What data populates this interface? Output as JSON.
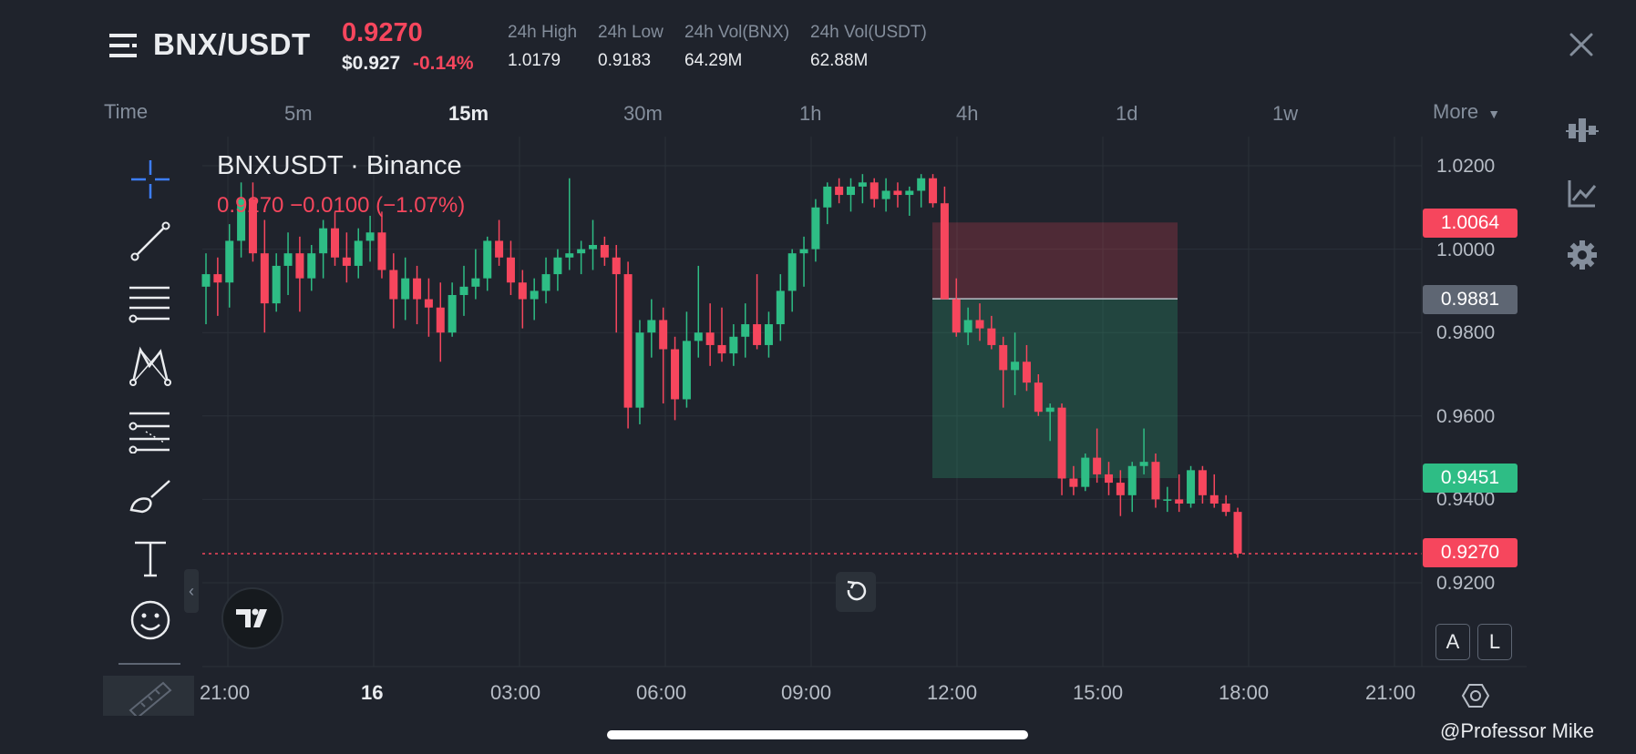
{
  "header": {
    "pair": "BNX/USDT",
    "price": "0.9270",
    "usd_price": "$0.927",
    "change_pct": "-0.14%",
    "stats": [
      {
        "label": "24h High",
        "value": "1.0179"
      },
      {
        "label": "24h Low",
        "value": "0.9183"
      },
      {
        "label": "24h Vol(BNX)",
        "value": "64.29M"
      },
      {
        "label": "24h Vol(USDT)",
        "value": "62.88M"
      }
    ]
  },
  "timeframes": {
    "time_label": "Time",
    "items": [
      "5m",
      "15m",
      "30m",
      "1h",
      "4h",
      "1d",
      "1w"
    ],
    "active": "15m",
    "more_label": "More"
  },
  "chart": {
    "title": "BNXUSDT · Binance",
    "ohlc_text": "0.9270  −0.0100 (−1.07%)",
    "position_tool": {
      "stop": "1.0064",
      "entry": "0.9881",
      "target": "0.9451"
    },
    "last_price": "0.9270",
    "auto_label": "A",
    "log_label": "L",
    "colors": {
      "up": "#2ebd85",
      "down": "#f6465d",
      "bg": "#1f232c",
      "grid": "#2b3139"
    }
  },
  "chart_data": {
    "type": "candlestick",
    "title": "BNXUSDT · Binance",
    "ylim": [
      0.915,
      1.022
    ],
    "yticks": [
      "1.0200",
      "1.0000",
      "0.9800",
      "0.9600",
      "0.9400",
      "0.9200"
    ],
    "xticks": [
      "21:00",
      "16",
      "03:00",
      "06:00",
      "09:00",
      "12:00",
      "15:00",
      "18:00",
      "21:00"
    ],
    "interval": "15m",
    "candles": [
      [
        0.991,
        0.999,
        0.982,
        0.994
      ],
      [
        0.994,
        0.998,
        0.984,
        0.992
      ],
      [
        0.992,
        1.006,
        0.986,
        1.002
      ],
      [
        1.002,
        1.016,
        0.998,
        1.012
      ],
      [
        1.012,
        1.016,
        0.997,
        0.999
      ],
      [
        0.999,
        1.007,
        0.98,
        0.987
      ],
      [
        0.987,
        0.999,
        0.985,
        0.996
      ],
      [
        0.996,
        1.004,
        0.989,
        0.999
      ],
      [
        0.999,
        1.003,
        0.985,
        0.993
      ],
      [
        0.993,
        1.001,
        0.99,
        0.999
      ],
      [
        0.999,
        1.007,
        0.993,
        1.005
      ],
      [
        1.005,
        1.009,
        0.996,
        0.998
      ],
      [
        0.998,
        1.004,
        0.992,
        0.996
      ],
      [
        0.996,
        1.005,
        0.993,
        1.002
      ],
      [
        1.002,
        1.008,
        0.997,
        1.004
      ],
      [
        1.004,
        1.009,
        0.993,
        0.995
      ],
      [
        0.995,
        0.999,
        0.981,
        0.988
      ],
      [
        0.988,
        0.998,
        0.983,
        0.993
      ],
      [
        0.993,
        0.996,
        0.982,
        0.988
      ],
      [
        0.988,
        0.993,
        0.979,
        0.986
      ],
      [
        0.986,
        0.992,
        0.973,
        0.98
      ],
      [
        0.98,
        0.992,
        0.979,
        0.989
      ],
      [
        0.989,
        0.996,
        0.984,
        0.991
      ],
      [
        0.991,
        1.0,
        0.988,
        0.993
      ],
      [
        0.993,
        1.003,
        0.99,
        1.002
      ],
      [
        1.002,
        1.007,
        0.996,
        0.998
      ],
      [
        0.998,
        1.002,
        0.989,
        0.992
      ],
      [
        0.992,
        0.995,
        0.981,
        0.988
      ],
      [
        0.988,
        0.993,
        0.983,
        0.99
      ],
      [
        0.99,
        0.998,
        0.987,
        0.994
      ],
      [
        0.994,
        1.0,
        0.99,
        0.998
      ],
      [
        0.998,
        1.017,
        0.995,
        0.999
      ],
      [
        0.999,
        1.002,
        0.994,
        1.0
      ],
      [
        1.0,
        1.007,
        0.995,
        1.001
      ],
      [
        1.001,
        1.003,
        0.996,
        0.998
      ],
      [
        0.998,
        1.001,
        0.98,
        0.994
      ],
      [
        0.994,
        0.997,
        0.957,
        0.962
      ],
      [
        0.962,
        0.983,
        0.958,
        0.98
      ],
      [
        0.98,
        0.988,
        0.974,
        0.983
      ],
      [
        0.983,
        0.986,
        0.963,
        0.976
      ],
      [
        0.976,
        0.979,
        0.959,
        0.964
      ],
      [
        0.964,
        0.985,
        0.962,
        0.978
      ],
      [
        0.978,
        0.996,
        0.974,
        0.98
      ],
      [
        0.98,
        0.987,
        0.972,
        0.977
      ],
      [
        0.977,
        0.986,
        0.973,
        0.975
      ],
      [
        0.975,
        0.982,
        0.972,
        0.979
      ],
      [
        0.979,
        0.987,
        0.974,
        0.982
      ],
      [
        0.982,
        0.994,
        0.976,
        0.977
      ],
      [
        0.977,
        0.985,
        0.974,
        0.982
      ],
      [
        0.982,
        0.994,
        0.978,
        0.99
      ],
      [
        0.99,
        1.0,
        0.985,
        0.999
      ],
      [
        0.999,
        1.003,
        0.991,
        1.0
      ],
      [
        1.0,
        1.012,
        0.997,
        1.01
      ],
      [
        1.01,
        1.016,
        1.006,
        1.015
      ],
      [
        1.015,
        1.017,
        1.011,
        1.013
      ],
      [
        1.013,
        1.017,
        1.009,
        1.015
      ],
      [
        1.015,
        1.018,
        1.011,
        1.016
      ],
      [
        1.016,
        1.017,
        1.01,
        1.012
      ],
      [
        1.012,
        1.017,
        1.009,
        1.014
      ],
      [
        1.014,
        1.016,
        1.01,
        1.013
      ],
      [
        1.013,
        1.015,
        1.008,
        1.014
      ],
      [
        1.014,
        1.018,
        1.01,
        1.017
      ],
      [
        1.017,
        1.018,
        1.01,
        1.011
      ],
      [
        1.011,
        1.015,
        0.99,
        0.988
      ],
      [
        0.988,
        0.993,
        0.979,
        0.98
      ],
      [
        0.98,
        0.986,
        0.977,
        0.983
      ],
      [
        0.983,
        0.987,
        0.978,
        0.981
      ],
      [
        0.981,
        0.984,
        0.976,
        0.977
      ],
      [
        0.977,
        0.979,
        0.962,
        0.971
      ],
      [
        0.971,
        0.98,
        0.965,
        0.973
      ],
      [
        0.973,
        0.977,
        0.966,
        0.968
      ],
      [
        0.968,
        0.97,
        0.96,
        0.961
      ],
      [
        0.961,
        0.963,
        0.954,
        0.962
      ],
      [
        0.962,
        0.963,
        0.941,
        0.945
      ],
      [
        0.945,
        0.948,
        0.941,
        0.943
      ],
      [
        0.943,
        0.951,
        0.942,
        0.95
      ],
      [
        0.95,
        0.957,
        0.944,
        0.946
      ],
      [
        0.946,
        0.949,
        0.941,
        0.944
      ],
      [
        0.944,
        0.947,
        0.936,
        0.941
      ],
      [
        0.941,
        0.949,
        0.937,
        0.948
      ],
      [
        0.948,
        0.957,
        0.946,
        0.949
      ],
      [
        0.949,
        0.951,
        0.938,
        0.94
      ],
      [
        0.94,
        0.943,
        0.937,
        0.94
      ],
      [
        0.94,
        0.946,
        0.937,
        0.939
      ],
      [
        0.939,
        0.948,
        0.938,
        0.947
      ],
      [
        0.947,
        0.948,
        0.939,
        0.941
      ],
      [
        0.941,
        0.946,
        0.938,
        0.939
      ],
      [
        0.939,
        0.941,
        0.936,
        0.937
      ],
      [
        0.937,
        0.938,
        0.926,
        0.927
      ]
    ]
  },
  "toolbar_icons": [
    "crosshair-icon",
    "trendline-icon",
    "fib-icon",
    "pattern-icon",
    "prediction-icon",
    "brush-icon",
    "text-icon",
    "emoji-icon",
    "ruler-icon"
  ],
  "right_icons": [
    "indicators-icon",
    "chart-type-icon",
    "settings-icon"
  ],
  "watermark": "@Professor Mike"
}
